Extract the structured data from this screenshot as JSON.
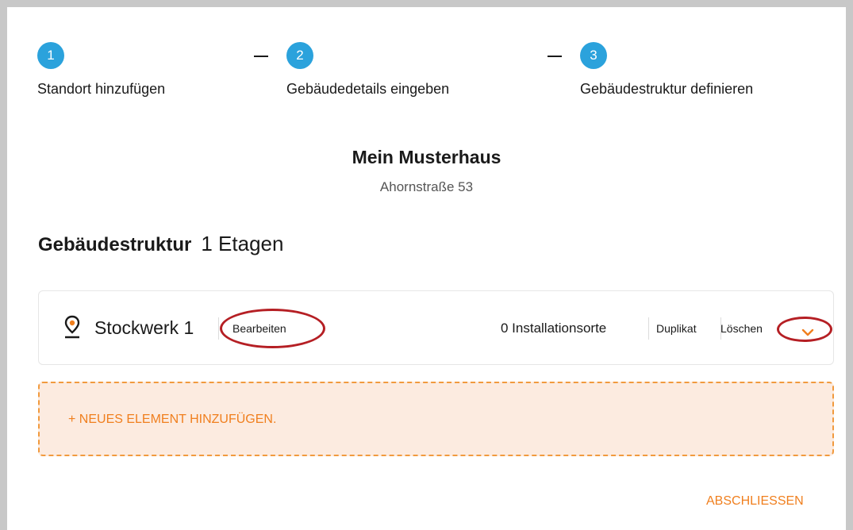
{
  "stepper": {
    "steps": [
      {
        "number": "1",
        "label": "Standort hinzufügen"
      },
      {
        "number": "2",
        "label": "Gebäudedetails eingeben"
      },
      {
        "number": "3",
        "label": "Gebäudestruktur definieren"
      }
    ],
    "active_color": "#2ba2dc"
  },
  "building": {
    "name": "Mein Musterhaus",
    "address": "Ahornstraße 53"
  },
  "structure": {
    "heading": "Gebäudestruktur",
    "floor_count_label": "1 Etagen"
  },
  "floor": {
    "name": "Stockwerk 1",
    "edit_label": "Bearbeiten",
    "installation_count_label": "0 Installationsorte",
    "duplicate_label": "Duplikat",
    "delete_label": "Löschen",
    "icon": "location-pin-icon"
  },
  "add_element": {
    "label": "+ NEUES ELEMENT HINZUFÜGEN."
  },
  "footer": {
    "finish_label": "ABSCHLIESSEN"
  },
  "colors": {
    "accent": "#f07f1e",
    "highlight": "#b51f24",
    "step": "#2ba2dc"
  }
}
